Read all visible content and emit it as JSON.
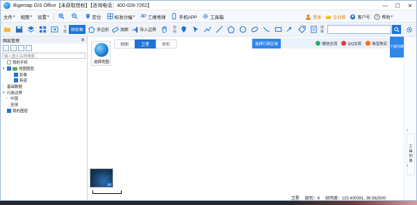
{
  "window": {
    "title": "Bigemap GIS Office【未获取授权】【咨询电话：400-028-7262】",
    "buttons": [
      "—",
      "☐",
      "✕"
    ]
  },
  "menu": {
    "items": [
      {
        "label": "文件",
        "caret": "▾"
      },
      {
        "label": "视图",
        "caret": "▾"
      },
      {
        "label": "设置",
        "caret": "▾"
      },
      {
        "label": "定位"
      },
      {
        "label": "标准分幅",
        "caret": "▾"
      },
      {
        "label": "三维地球",
        "prefix": "3D"
      },
      {
        "label": "手机APP"
      },
      {
        "label": "工具箱"
      }
    ],
    "right": [
      {
        "label": "登录"
      },
      {
        "label": "企业版"
      },
      {
        "label": "客户号"
      },
      {
        "label": "帮助",
        "caret": "▾"
      }
    ]
  },
  "toolbar": {
    "vertical_label_1": "下载",
    "rect_label": "矩形框",
    "polygon_label": "多边形",
    "measure_label": "测距",
    "import_label": "导入边界",
    "vertical_label_2": "标绘",
    "search_vertical_label": "搜索",
    "search_value": ""
  },
  "left_panel": {
    "title": "图层管理",
    "close": "✕",
    "search_placeholder": "输入图元名称搜索...",
    "tree": [
      {
        "label": "我的手机",
        "arrow": "",
        "check": "empty",
        "indent": 0
      },
      {
        "label": "地图图层",
        "arrow": "▾",
        "check": "checked",
        "indent": 0,
        "folder": true
      },
      {
        "label": "影像",
        "arrow": "",
        "check": "checked",
        "indent": 2
      },
      {
        "label": "街道",
        "arrow": "",
        "check": "checked",
        "indent": 2
      },
      {
        "label": "基础数据",
        "arrow": "›",
        "check": "none",
        "indent": 0
      },
      {
        "label": "行政边界",
        "arrow": "▾",
        "check": "none",
        "indent": 0
      },
      {
        "label": "中国",
        "arrow": "›",
        "check": "none",
        "indent": 1
      },
      {
        "label": "全球",
        "arrow": "",
        "check": "none",
        "indent": 1
      },
      {
        "label": "我的图层",
        "arrow": "",
        "check": "checked",
        "indent": 0
      }
    ]
  },
  "map": {
    "globe_label": "选择地图",
    "tabs": [
      "地图",
      "卫星",
      "地形"
    ],
    "active_tab": "卫星",
    "region_label": "选择行政区域",
    "shares": [
      {
        "label": "微信交流",
        "color": "#2aae67"
      },
      {
        "label": "QQ交流",
        "color": "#e23b3b"
      },
      {
        "label": "淘宝购买",
        "color": "#ff6a00"
      }
    ],
    "download_list": "下载列表",
    "toolbox_tab": [
      "工",
      "具",
      "列",
      "表"
    ],
    "mini_map_badge": "3D"
  },
  "status": {
    "mode": "卫星",
    "zoom": "级别：6",
    "coords": "经纬度：115.400391, 36.562500"
  },
  "colors": {
    "accent": "#1e73d8",
    "panel_border": "#c8d4e3",
    "orange": "#e37a12"
  }
}
